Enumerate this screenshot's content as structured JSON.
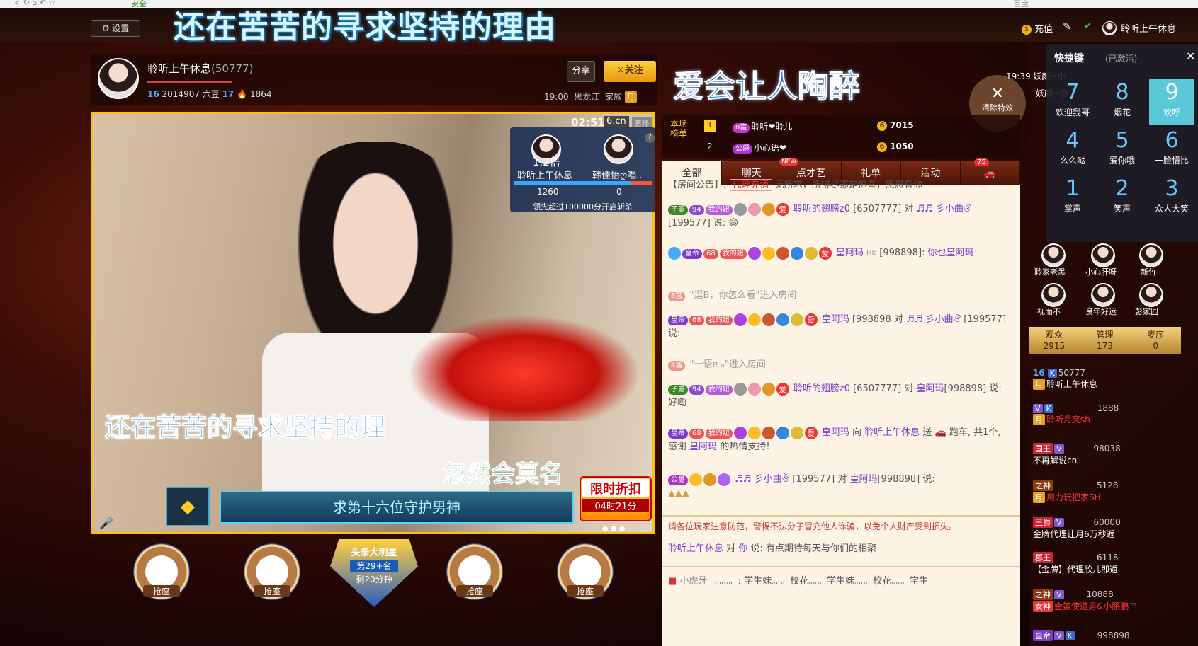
{
  "browser": {
    "left": "安全",
    "right": "百度"
  },
  "topbar": {
    "settings": "设置",
    "banner": "还在苦苦的寻求坚持的理由",
    "recharge": "充值",
    "username": "聆听上午休息"
  },
  "anchor": {
    "name": "聆听上午休息",
    "id": "(50777)",
    "level_left": "16",
    "sixbean": "2014907 六豆",
    "level_right": "17",
    "fire": "1864",
    "share": "分享",
    "follow": "关注",
    "time": "19:00",
    "location": "黑龙江",
    "family": "家族",
    "family_tag": "月"
  },
  "banner2": "爱会让人陶醉",
  "clear_effects": "清除特效",
  "video": {
    "time": "02:51",
    "site": "6.cn",
    "live": "直播",
    "subtitle1": "还在苦苦的寻求坚持的理",
    "subtitle2": "忽然会莫名",
    "guard_text": "求第十六位守护男神",
    "discount_title": "限时折扣",
    "discount_time": "04时21分",
    "pk": {
      "mult": "1.2倍",
      "left_name": "聆听上午休息",
      "right_name": "韩佳怡ღ唱..",
      "left_score": "1260",
      "right_score": "0",
      "note": "领先超过100000分开启斩杀"
    }
  },
  "seats": {
    "label": "抢座",
    "star": {
      "title": "头条大明星",
      "rank": "第29+名",
      "remain": "剩20分钟"
    }
  },
  "rank": {
    "label": "本场榜单",
    "rows": [
      {
        "n": "1",
        "name": "聆听❤聆儿",
        "tag": "8富",
        "coins": "7015"
      },
      {
        "n": "2",
        "name": "小心语❤",
        "tag": "公爵",
        "coins": "1050"
      }
    ]
  },
  "tabs": [
    "全部",
    "聊天",
    "点才艺",
    "礼单",
    "活动"
  ],
  "tab_badges": {
    "new": "NEW",
    "car": "75"
  },
  "chat": {
    "notice_label": "【房间公告】:",
    "notice_tag": "代理充值",
    "notice": "无所求，所得尽都是惊喜，感恩有你",
    "m1_tag": "子爵",
    "m1_lv": "94",
    "m1_fan": "我的妞",
    "m1_a": "聆听的翅膀z0",
    "m1_ida": "[6507777]",
    "m1_to": "对",
    "m1_b": "♬♬ 彡小曲ঔ",
    "m1_idb": "[199577]",
    "m1_say": "说:",
    "m2_tag": "皇帝",
    "m2_lv": "68",
    "m2_fan": "我的妞",
    "m2_ai": "爱",
    "m2_name": "皇阿玛",
    "m2_hk": "HK",
    "m2_id": "[998898]:",
    "m2_text": "你也皇阿玛",
    "m3_tag": "6富",
    "m3_text": "\"逗B，你怎么看\"进入房间",
    "m4_tag": "皇帝",
    "m4_lv": "68",
    "m4_fan": "我的妞",
    "m4_ai": "爱",
    "m4_name": "皇阿玛",
    "m4_id": "[998898",
    "m4_to": "对",
    "m4_b": "♬♬ 彡小曲ঔ",
    "m4_idb": "[199577]",
    "m4_say": "说:",
    "m5_tag": "4富",
    "m5_text": "\"一语e ᵤ\"进入房间",
    "m6_tag": "子爵",
    "m6_lv": "94",
    "m6_fan": "我的妞",
    "m6_ai": "爱",
    "m6_a": "聆听的翅膀z0",
    "m6_ida": "[6507777]",
    "m6_to": "对",
    "m6_b": "皇阿玛",
    "m6_idb": "[998898]",
    "m6_say": "说: 好嘞",
    "m7_tag": "皇帝",
    "m7_lv": "68",
    "m7_fan": "我的妞",
    "m7_ai": "爱",
    "m7_a": "皇阿玛",
    "m7_to": "向",
    "m7_b": "聆听上午休息",
    "m7_gift": "送",
    "m7_gift2": "跑车, 共1个, 感谢",
    "m7_name": "皇阿玛",
    "m7_thanks": "的热情支持!",
    "m8_tag": "公爵",
    "m8_a": "♬♬ 彡小曲ঔ",
    "m8_ida": "[199577]",
    "m8_to": "对",
    "m8_b": "皇阿玛",
    "m8_idb": "[998898]",
    "m8_say": "说:",
    "warning": "请各位玩家注意防范，警惕不法分子冒充他人诈骗，以免个人财产受到损失。",
    "private_from": "聆听上午休息",
    "private_to": "对",
    "private_target": "你",
    "private_say": "说:",
    "private_text": "有点期待每天与你们的相聚",
    "marquee_name": "小虎牙",
    "marquee": "。。。。。: 学生妹。。。校花。。。学生妹。。。校花。。。学生"
  },
  "hotkey": {
    "title": "快捷键",
    "state": "(已激活)",
    "keys": [
      {
        "k": "7",
        "label": "欢迎我哥"
      },
      {
        "k": "8",
        "label": "烟花"
      },
      {
        "k": "9",
        "label": "欢呼"
      },
      {
        "k": "4",
        "label": "么么哒"
      },
      {
        "k": "5",
        "label": "爱你哦"
      },
      {
        "k": "6",
        "label": "一脸懵比"
      },
      {
        "k": "1",
        "label": "掌声"
      },
      {
        "k": "2",
        "label": "笑声"
      },
      {
        "k": "3",
        "label": "众人大笑"
      }
    ]
  },
  "chat_right_top": {
    "time": "19:39",
    "l1": "妖颜~小",
    "l2": "妖颜~小"
  },
  "guards": [
    "聆家老黑",
    "小心肝呀",
    "新竹",
    "视而不",
    "良年好运",
    "彭家园"
  ],
  "viewers": {
    "audience": "观众",
    "audience_n": "2915",
    "admin": "管理",
    "admin_n": "173",
    "mic": "麦序",
    "mic_n": "0"
  },
  "users": [
    {
      "lv": "16",
      "extra": "50777",
      "tag": "月",
      "name": "聆听上午休息"
    },
    {
      "tag": "月",
      "name": "聆听月亮sh",
      "num": "1888"
    },
    {
      "tag": "国王",
      "name": "不再解说cn",
      "num": "98038"
    },
    {
      "tag": "月",
      "name": "用力玩把家SH",
      "num": "5128"
    },
    {
      "tag": "王爵",
      "name": "金牌代理让月6万秒返",
      "num": "60000"
    },
    {
      "tag": "郡王",
      "name": "【金牌】代理欣儿即返",
      "num": "6118"
    },
    {
      "tag": "女神",
      "name": "金笛使道男&小鹏鹏™",
      "num": "10888"
    },
    {
      "tag": "皇帝",
      "name": "",
      "num": "998898"
    }
  ],
  "colors": {
    "accent": "#f6c21a",
    "chat_bg": "#fdf4e6",
    "brand_purple": "#7a3ad0"
  }
}
